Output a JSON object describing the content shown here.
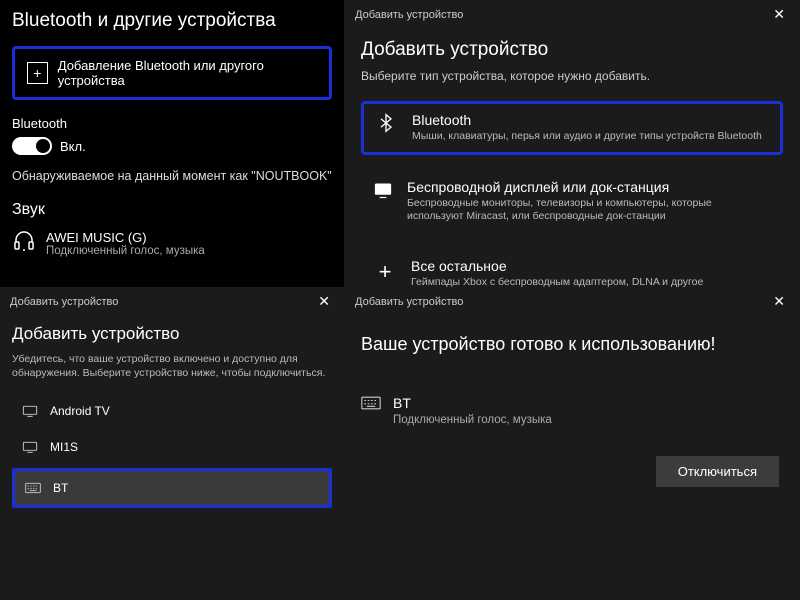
{
  "top_left": {
    "heading": "Bluetooth и другие устройства",
    "add_label": "Добавление Bluetooth или другого устройства",
    "bt_label": "Bluetooth",
    "bt_on": "Вкл.",
    "discoverable": "Обнаруживаемое на данный момент как \"NOUTBOOK\"",
    "sound_heading": "Звук",
    "device_name": "AWEI MUSIC (G)",
    "device_status": "Подключенный голос, музыка"
  },
  "top_right": {
    "titlebar": "Добавить устройство",
    "heading": "Добавить устройство",
    "hint": "Выберите тип устройства, которое нужно добавить.",
    "opt1_title": "Bluetooth",
    "opt1_desc": "Мыши, клавиатуры, перья или аудио и другие типы устройств Bluetooth",
    "opt2_title": "Беспроводной дисплей или док-станция",
    "opt2_desc": "Беспроводные мониторы, телевизоры и компьютеры, которые используют Miracast, или беспроводные док-станции",
    "opt3_title": "Все остальное",
    "opt3_desc": "Геймпады Xbox с беспроводным адаптером, DLNA и другое"
  },
  "bottom_left": {
    "titlebar": "Добавить устройство",
    "heading": "Добавить устройство",
    "hint": "Убедитесь, что ваше устройство включено и доступно для обнаружения. Выберите устройство ниже, чтобы подключиться.",
    "items": [
      {
        "name": "Android TV"
      },
      {
        "name": "MI1S"
      },
      {
        "name": "BT"
      }
    ]
  },
  "bottom_right": {
    "titlebar": "Добавить устройство",
    "heading": "Ваше устройство готово к использованию!",
    "device_name": "BT",
    "device_status": "Подключенный голос, музыка",
    "disconnect": "Отключиться"
  }
}
